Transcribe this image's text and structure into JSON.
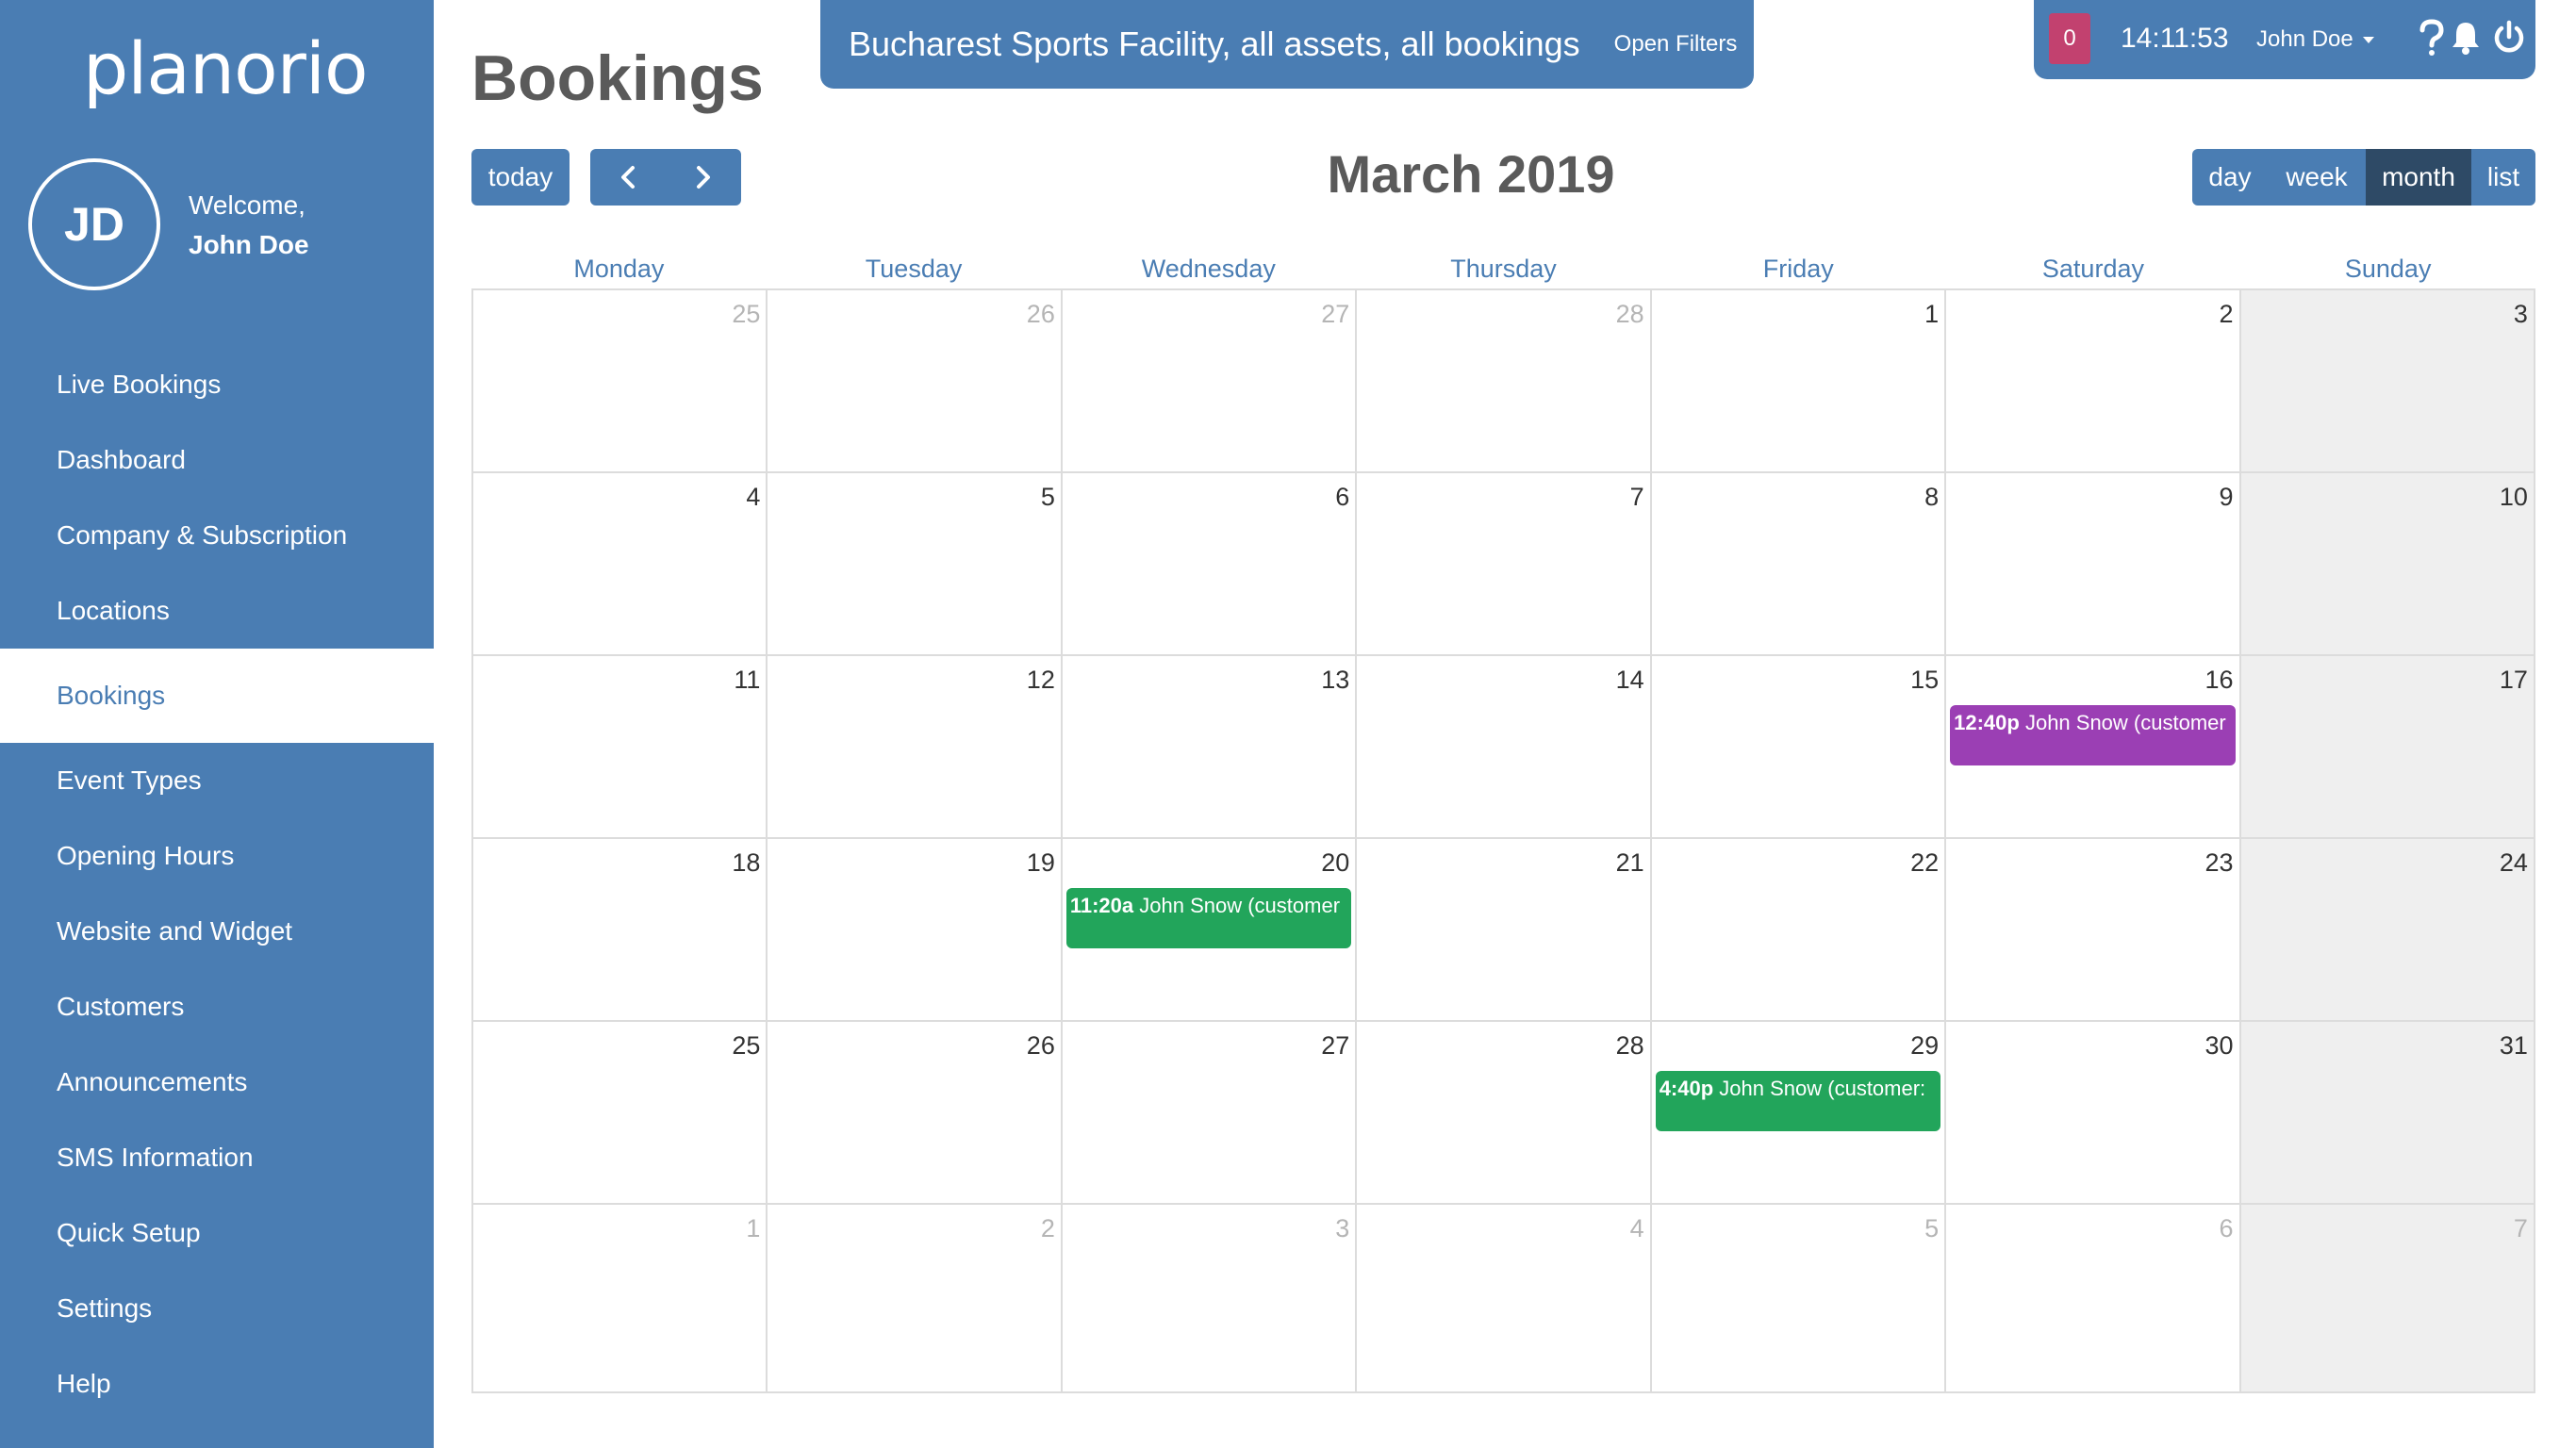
{
  "brand": {
    "logo": "planorio"
  },
  "user": {
    "initials": "JD",
    "welcome": "Welcome,",
    "name": "John Doe"
  },
  "nav": [
    {
      "label": "Live Bookings"
    },
    {
      "label": "Dashboard"
    },
    {
      "label": "Company & Subscription"
    },
    {
      "label": "Locations"
    },
    {
      "label": "Bookings",
      "active": true
    },
    {
      "label": "Event Types"
    },
    {
      "label": "Opening Hours"
    },
    {
      "label": "Website and Widget"
    },
    {
      "label": "Customers"
    },
    {
      "label": "Announcements"
    },
    {
      "label": "SMS Information"
    },
    {
      "label": "Quick Setup"
    },
    {
      "label": "Settings"
    },
    {
      "label": "Help"
    }
  ],
  "page": {
    "title": "Bookings"
  },
  "filter": {
    "text": "Bucharest Sports Facility, all assets, all bookings",
    "open_label": "Open Filters"
  },
  "topbar": {
    "notifications": "0",
    "clock": "14:11:53",
    "user": "John Doe",
    "icons": [
      "help-icon",
      "bell-icon",
      "power-icon"
    ]
  },
  "toolbar": {
    "today": "today",
    "prev_icon": "chevron-left-icon",
    "next_icon": "chevron-right-icon",
    "title": "March 2019",
    "views": [
      {
        "label": "day"
      },
      {
        "label": "week"
      },
      {
        "label": "month",
        "active": true
      },
      {
        "label": "list"
      }
    ]
  },
  "calendar": {
    "weekdays": [
      "Monday",
      "Tuesday",
      "Wednesday",
      "Thursday",
      "Friday",
      "Saturday",
      "Sunday"
    ],
    "weeks": [
      [
        "25",
        "26",
        "27",
        "28",
        "1",
        "2",
        "3"
      ],
      [
        "4",
        "5",
        "6",
        "7",
        "8",
        "9",
        "10"
      ],
      [
        "11",
        "12",
        "13",
        "14",
        "15",
        "16",
        "17"
      ],
      [
        "18",
        "19",
        "20",
        "21",
        "22",
        "23",
        "24"
      ],
      [
        "25",
        "26",
        "27",
        "28",
        "29",
        "30",
        "31"
      ],
      [
        "1",
        "2",
        "3",
        "4",
        "5",
        "6",
        "7"
      ]
    ],
    "events": [
      {
        "week": 2,
        "day": 5,
        "time": "12:40p",
        "title": "John Snow (customer",
        "color": "#9b3fb4"
      },
      {
        "week": 3,
        "day": 2,
        "time": "11:20a",
        "title": "John Snow (customer",
        "color": "#22a55b"
      },
      {
        "week": 4,
        "day": 4,
        "time": "4:40p",
        "title": "John Snow (customer:",
        "color": "#22a55b"
      }
    ]
  },
  "colors": {
    "primary": "#4a7db3",
    "active_view": "#2e4a66",
    "badge": "#c2416f"
  }
}
